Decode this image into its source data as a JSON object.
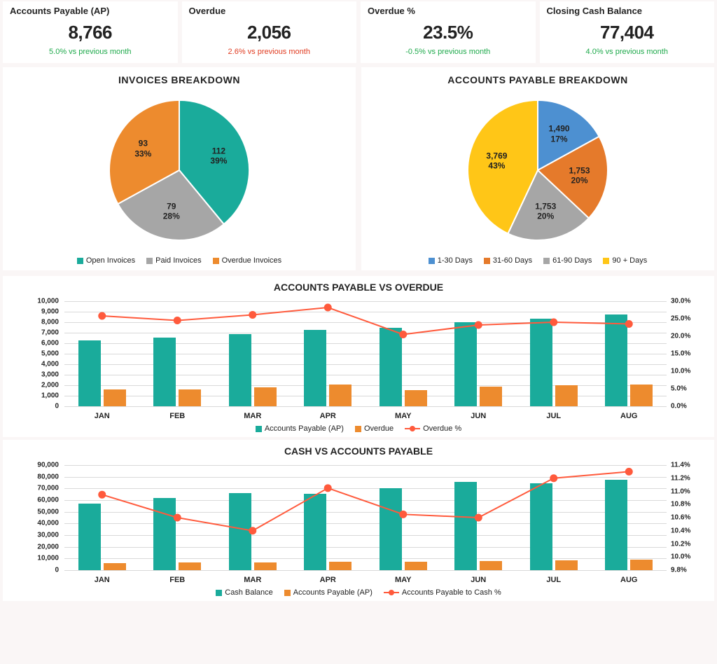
{
  "colors": {
    "teal": "#1aab9b",
    "gray": "#a6a6a6",
    "orange": "#ed8b2e",
    "blue": "#4d90d1",
    "darkorange": "#e57a2b",
    "yellow": "#ffc617",
    "red": "#ff5a3c"
  },
  "kpi": [
    {
      "title": "Accounts Payable (AP)",
      "value": "8,766",
      "sub": "5.0% vs previous month",
      "cls": "pos"
    },
    {
      "title": "Overdue",
      "value": "2,056",
      "sub": "2.6% vs previous month",
      "cls": "neg"
    },
    {
      "title": "Overdue %",
      "value": "23.5%",
      "sub": "-0.5% vs previous month",
      "cls": "pos"
    },
    {
      "title": "Closing Cash Balance",
      "value": "77,404",
      "sub": "4.0% vs previous month",
      "cls": "pos"
    }
  ],
  "chart_data": [
    {
      "id": "invoices",
      "type": "pie",
      "title": "INVOICES BREAKDOWN",
      "slices": [
        {
          "name": "Open Invoices",
          "value": 112,
          "pct": 39,
          "color": "teal"
        },
        {
          "name": "Paid Invoices",
          "value": 79,
          "pct": 28,
          "color": "gray"
        },
        {
          "name": "Overdue Invoices",
          "value": 93,
          "pct": 33,
          "color": "orange"
        }
      ]
    },
    {
      "id": "ap_breakdown",
      "type": "pie",
      "title": "ACCOUNTS PAYABLE BREAKDOWN",
      "slices": [
        {
          "name": "1-30 Days",
          "value": 1490,
          "pct": 17,
          "color": "blue"
        },
        {
          "name": "31-60 Days",
          "value": 1753,
          "pct": 20,
          "color": "darkorange"
        },
        {
          "name": "61-90 Days",
          "value": 1753,
          "pct": 20,
          "color": "gray"
        },
        {
          "name": "90 + Days",
          "value": 3769,
          "pct": 43,
          "color": "yellow"
        }
      ]
    },
    {
      "id": "ap_vs_overdue",
      "type": "bar+line",
      "title": "ACCOUNTS PAYABLE VS OVERDUE",
      "categories": [
        "JAN",
        "FEB",
        "MAR",
        "APR",
        "MAY",
        "JUN",
        "JUL",
        "AUG"
      ],
      "series": [
        {
          "name": "Accounts Payable (AP)",
          "kind": "bar",
          "color": "teal",
          "values": [
            6240,
            6550,
            6890,
            7240,
            7500,
            8000,
            8350,
            8766
          ]
        },
        {
          "name": "Overdue",
          "kind": "bar",
          "color": "orange",
          "values": [
            1610,
            1600,
            1800,
            2040,
            1540,
            1850,
            2000,
            2056
          ]
        },
        {
          "name": "Overdue %",
          "kind": "line",
          "color": "red",
          "values": [
            25.8,
            24.5,
            26.1,
            28.2,
            20.5,
            23.2,
            24.0,
            23.5
          ]
        }
      ],
      "ylim": [
        0,
        10000
      ],
      "yticks": [
        0,
        1000,
        2000,
        3000,
        4000,
        5000,
        6000,
        7000,
        8000,
        9000,
        10000
      ],
      "ylim2": [
        0,
        30
      ],
      "yticks2": [
        0,
        5,
        10,
        15,
        20,
        25,
        30
      ],
      "y2suffix": ".0%"
    },
    {
      "id": "cash_vs_ap",
      "type": "bar+line",
      "title": "CASH VS ACCOUNTS PAYABLE",
      "categories": [
        "JAN",
        "FEB",
        "MAR",
        "APR",
        "MAY",
        "JUN",
        "JUL",
        "AUG"
      ],
      "series": [
        {
          "name": "Cash Balance",
          "kind": "bar",
          "color": "teal",
          "values": [
            57000,
            62000,
            66000,
            65500,
            70500,
            75500,
            74500,
            77404
          ]
        },
        {
          "name": "Accounts Payable (AP)",
          "kind": "bar",
          "color": "orange",
          "values": [
            6240,
            6550,
            6890,
            7240,
            7500,
            8000,
            8350,
            8766
          ]
        },
        {
          "name": "Accounts Payable to Cash %",
          "kind": "line",
          "color": "red",
          "values": [
            10.95,
            10.6,
            10.4,
            11.05,
            10.65,
            10.6,
            11.2,
            11.3
          ]
        }
      ],
      "ylim": [
        0,
        90000
      ],
      "yticks": [
        0,
        10000,
        20000,
        30000,
        40000,
        50000,
        60000,
        70000,
        80000,
        90000
      ],
      "ylim2": [
        9.8,
        11.4
      ],
      "yticks2": [
        9.8,
        10.0,
        10.2,
        10.4,
        10.6,
        10.8,
        11.0,
        11.2,
        11.4
      ],
      "y2suffix": "%"
    }
  ]
}
